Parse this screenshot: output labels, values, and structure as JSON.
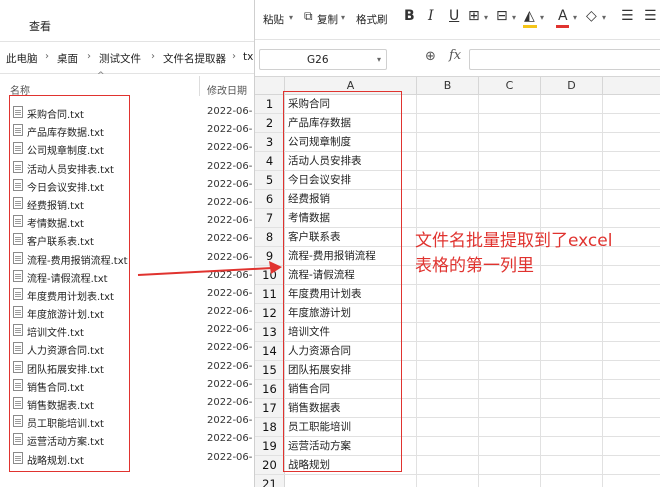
{
  "explorer": {
    "ribbon_tab": "查看",
    "breadcrumb": [
      "此电脑",
      "桌面",
      "测试文件",
      "文件名提取器",
      "tx"
    ],
    "columns": {
      "name": "名称",
      "date": "修改日期"
    },
    "files": [
      {
        "name": "采购合同.txt",
        "date": "2022-06-"
      },
      {
        "name": "产品库存数据.txt",
        "date": "2022-06-"
      },
      {
        "name": "公司规章制度.txt",
        "date": "2022-06-"
      },
      {
        "name": "活动人员安排表.txt",
        "date": "2022-06-"
      },
      {
        "name": "今日会议安排.txt",
        "date": "2022-06-"
      },
      {
        "name": "经费报销.txt",
        "date": "2022-06-"
      },
      {
        "name": "考情数据.txt",
        "date": "2022-06-"
      },
      {
        "name": "客户联系表.txt",
        "date": "2022-06-"
      },
      {
        "name": "流程-费用报销流程.txt",
        "date": "2022-06-"
      },
      {
        "name": "流程-请假流程.txt",
        "date": "2022-06-"
      },
      {
        "name": "年度费用计划表.txt",
        "date": "2022-06-"
      },
      {
        "name": "年度旅游计划.txt",
        "date": "2022-06-"
      },
      {
        "name": "培训文件.txt",
        "date": "2022-06-"
      },
      {
        "name": "人力资源合同.txt",
        "date": "2022-06-"
      },
      {
        "name": "团队拓展安排.txt",
        "date": "2022-06-"
      },
      {
        "name": "销售合同.txt",
        "date": "2022-06-"
      },
      {
        "name": "销售数据表.txt",
        "date": "2022-06-"
      },
      {
        "name": "员工职能培训.txt",
        "date": "2022-06-"
      },
      {
        "name": "运营活动方案.txt",
        "date": "2022-06-"
      },
      {
        "name": "战略规划.txt",
        "date": "2022-06-"
      }
    ]
  },
  "toolbar": {
    "paste": "粘贴",
    "copy": "复制",
    "format_painter": "格式刷",
    "bold": "B",
    "italic": "I",
    "underline": "U",
    "font_color": "A"
  },
  "formula_bar": {
    "name_box": "G26",
    "fx": "fx"
  },
  "sheet": {
    "columns": [
      "A",
      "B",
      "C",
      "D"
    ],
    "rows": [
      {
        "num": "1",
        "a": "采购合同"
      },
      {
        "num": "2",
        "a": "产品库存数据"
      },
      {
        "num": "3",
        "a": "公司规章制度"
      },
      {
        "num": "4",
        "a": "活动人员安排表"
      },
      {
        "num": "5",
        "a": "今日会议安排"
      },
      {
        "num": "6",
        "a": "经费报销"
      },
      {
        "num": "7",
        "a": "考情数据"
      },
      {
        "num": "8",
        "a": "客户联系表"
      },
      {
        "num": "9",
        "a": "流程-费用报销流程"
      },
      {
        "num": "10",
        "a": "流程-请假流程"
      },
      {
        "num": "11",
        "a": "年度费用计划表"
      },
      {
        "num": "12",
        "a": "年度旅游计划"
      },
      {
        "num": "13",
        "a": "培训文件"
      },
      {
        "num": "14",
        "a": "人力资源合同"
      },
      {
        "num": "15",
        "a": "团队拓展安排"
      },
      {
        "num": "16",
        "a": "销售合同"
      },
      {
        "num": "17",
        "a": "销售数据表"
      },
      {
        "num": "18",
        "a": "员工职能培训"
      },
      {
        "num": "19",
        "a": "运营活动方案"
      },
      {
        "num": "20",
        "a": "战略规划"
      },
      {
        "num": "21",
        "a": ""
      }
    ]
  },
  "annotation": {
    "line1": "文件名批量提取到了excel",
    "line2": "表格的第一列里"
  },
  "colors": {
    "annotation_red": "#e0332f",
    "highlight_yellow": "#f5c518",
    "font_red": "#e0332f"
  }
}
